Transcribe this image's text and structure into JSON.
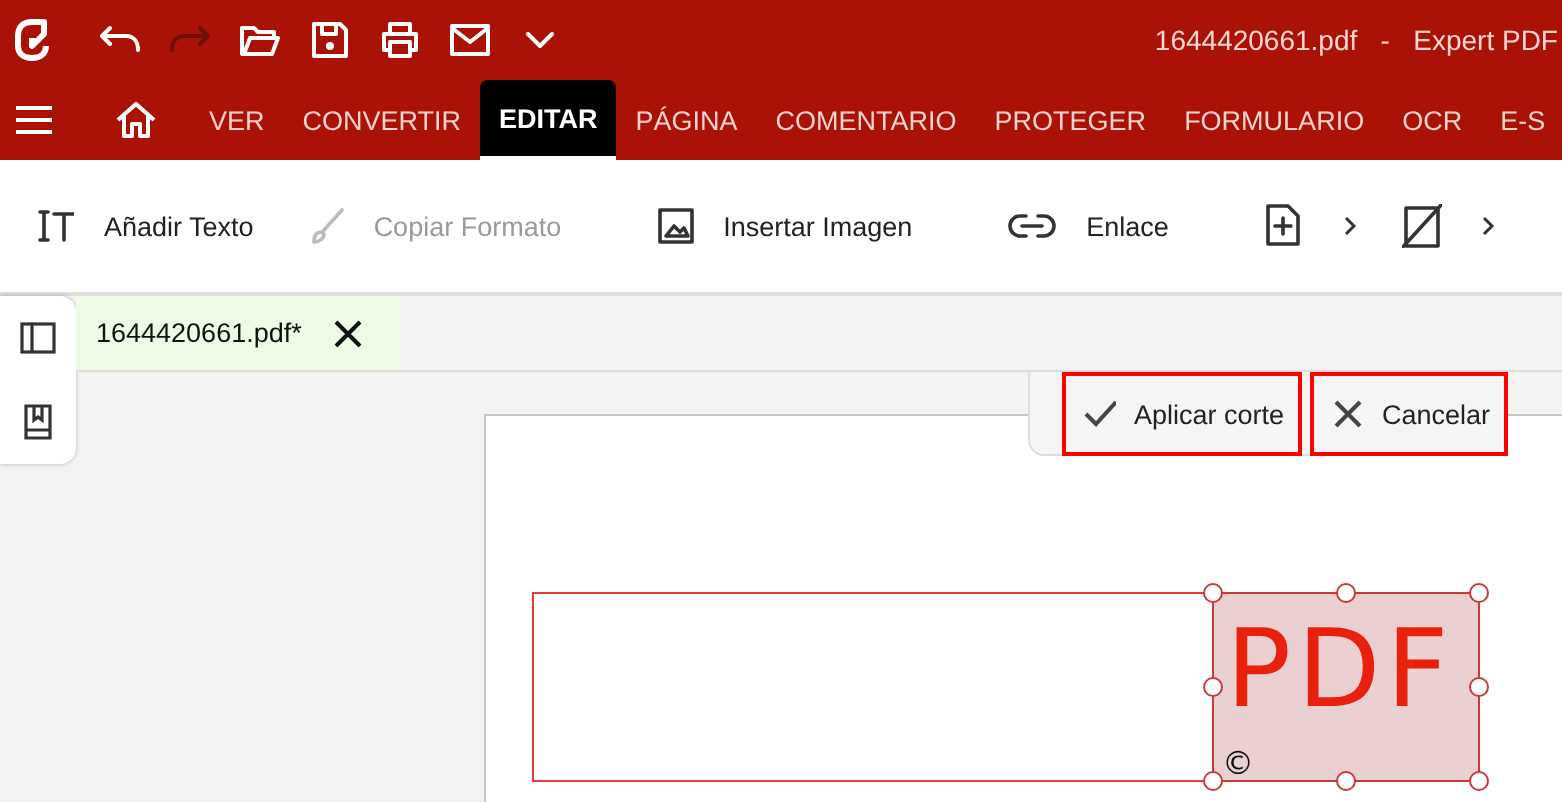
{
  "title_bar": {
    "quick_actions": [
      {
        "disabled": false
      },
      {
        "disabled": true
      },
      {
        "disabled": false
      },
      {
        "disabled": false
      },
      {
        "disabled": false
      },
      {
        "disabled": false
      },
      {
        "disabled": false
      }
    ],
    "title": "1644420661.pdf   -   Expert PDF"
  },
  "menu_tabs": [
    {
      "label": "VER",
      "selected": false
    },
    {
      "label": "CONVERTIR",
      "selected": false
    },
    {
      "label": "EDITAR",
      "selected": true
    },
    {
      "label": "PÁGINA",
      "selected": false
    },
    {
      "label": "COMENTARIO",
      "selected": false
    },
    {
      "label": "PROTEGER",
      "selected": false
    },
    {
      "label": "FORMULARIO",
      "selected": false
    },
    {
      "label": "OCR",
      "selected": false
    },
    {
      "label": "E-S",
      "selected": false
    }
  ],
  "toolbar": [
    {
      "kind": "button",
      "label": "Añadir Texto",
      "disabled": false
    },
    {
      "kind": "button",
      "label": "Copiar Formato",
      "disabled": true
    },
    {
      "kind": "button",
      "label": "Insertar Imagen",
      "disabled": false
    },
    {
      "kind": "button",
      "label": "Enlace",
      "disabled": false
    },
    {
      "kind": "menu",
      "disabled": false
    },
    {
      "kind": "menu",
      "disabled": false
    }
  ],
  "document_tab": {
    "label": "1644420661.pdf*",
    "selected": true
  },
  "crop_actions": [
    {
      "kind": "apply",
      "label": "Aplicar corte"
    },
    {
      "kind": "cancel",
      "label": "Cancelar"
    }
  ],
  "page": {
    "stamp_text": "PDF",
    "stamp_mark": "©"
  }
}
